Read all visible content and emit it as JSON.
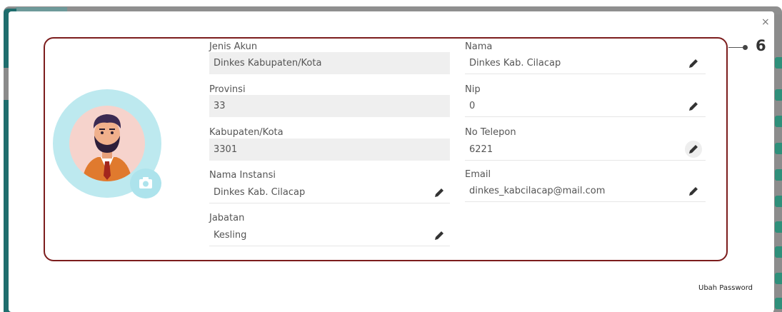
{
  "modal": {
    "close_label": "×",
    "callout_number": "6",
    "footer_link": "Ubah Password"
  },
  "fields": {
    "jenis_akun": {
      "label": "Jenis Akun",
      "value": "Dinkes Kabupaten/Kota"
    },
    "provinsi": {
      "label": "Provinsi",
      "value": "33"
    },
    "kabupaten_kota": {
      "label": "Kabupaten/Kota",
      "value": "3301"
    },
    "nama_instansi": {
      "label": "Nama Instansi",
      "value": "Dinkes Kab. Cilacap"
    },
    "jabatan": {
      "label": "Jabatan",
      "value": "Kesling"
    },
    "nama": {
      "label": "Nama",
      "value": "Dinkes Kab. Cilacap"
    },
    "nip": {
      "label": "Nip",
      "value": "0"
    },
    "no_telepon": {
      "label": "No Telepon",
      "value": "6221"
    },
    "email": {
      "label": "Email",
      "value": "dinkes_kabcilacap@mail.com"
    }
  },
  "colors": {
    "card_border": "#7c1d1d",
    "avatar_ring": "#bde9ef",
    "readonly_bg": "#efefef"
  },
  "icons": [
    "avatar-illustration",
    "camera-icon",
    "pencil-icon",
    "close-icon"
  ]
}
